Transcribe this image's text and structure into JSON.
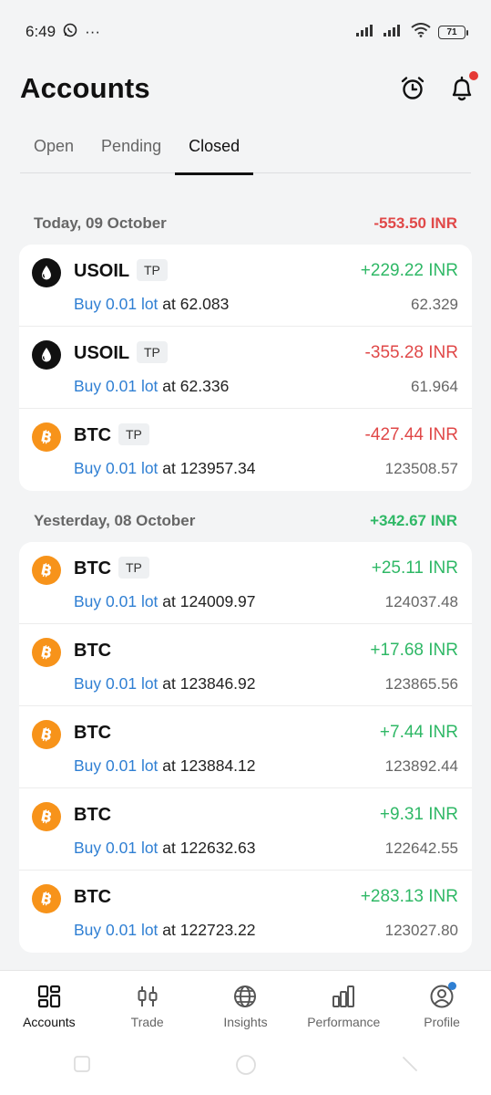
{
  "status_bar": {
    "time": "6:49",
    "dots": "···",
    "battery": "71"
  },
  "header": {
    "title": "Accounts",
    "alarm_icon": "alarm-clock-icon",
    "bell_icon": "bell-icon"
  },
  "tabs": [
    {
      "label": "Open"
    },
    {
      "label": "Pending"
    },
    {
      "label": "Closed"
    }
  ],
  "sections": [
    {
      "date": "Today, 09 October",
      "total": "-553.50 INR",
      "trades": [
        {
          "symbol": "USOIL",
          "tag": "TP",
          "side": "Buy 0.01 lot",
          "at": "at",
          "open": "62.083",
          "pnl": "+229.22 INR",
          "close": "62.329"
        },
        {
          "symbol": "USOIL",
          "tag": "TP",
          "side": "Buy 0.01 lot",
          "at": "at",
          "open": "62.336",
          "pnl": "-355.28 INR",
          "close": "61.964"
        },
        {
          "symbol": "BTC",
          "tag": "TP",
          "side": "Buy 0.01 lot",
          "at": "at",
          "open": "123957.34",
          "pnl": "-427.44 INR",
          "close": "123508.57"
        }
      ]
    },
    {
      "date": "Yesterday, 08 October",
      "total": "+342.67 INR",
      "trades": [
        {
          "symbol": "BTC",
          "tag": "TP",
          "side": "Buy 0.01 lot",
          "at": "at",
          "open": "124009.97",
          "pnl": "+25.11 INR",
          "close": "124037.48"
        },
        {
          "symbol": "BTC",
          "tag": "",
          "side": "Buy 0.01 lot",
          "at": "at",
          "open": "123846.92",
          "pnl": "+17.68 INR",
          "close": "123865.56"
        },
        {
          "symbol": "BTC",
          "tag": "",
          "side": "Buy 0.01 lot",
          "at": "at",
          "open": "123884.12",
          "pnl": "+7.44 INR",
          "close": "123892.44"
        },
        {
          "symbol": "BTC",
          "tag": "",
          "side": "Buy 0.01 lot",
          "at": "at",
          "open": "122632.63",
          "pnl": "+9.31 INR",
          "close": "122642.55"
        },
        {
          "symbol": "BTC",
          "tag": "",
          "side": "Buy 0.01 lot",
          "at": "at",
          "open": "122723.22",
          "pnl": "+283.13 INR",
          "close": "123027.80"
        }
      ]
    }
  ],
  "bottom_nav": [
    {
      "label": "Accounts",
      "icon": "accounts-grid-icon"
    },
    {
      "label": "Trade",
      "icon": "trade-candles-icon"
    },
    {
      "label": "Insights",
      "icon": "globe-icon"
    },
    {
      "label": "Performance",
      "icon": "bar-chart-icon"
    },
    {
      "label": "Profile",
      "icon": "profile-icon"
    }
  ],
  "colors": {
    "positive": "#2fb866",
    "negative": "#e04848",
    "link": "#2f7fd3",
    "btc": "#f7931a"
  }
}
